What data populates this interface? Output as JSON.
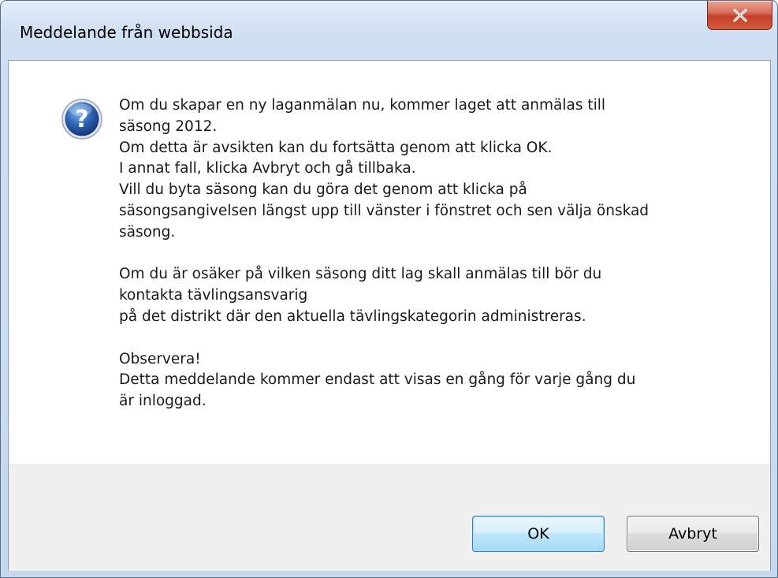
{
  "window": {
    "title": "Meddelande från webbsida"
  },
  "icons": {
    "close": "close-icon",
    "question": "question-icon"
  },
  "colors": {
    "close_button": "#c7432d",
    "question_icon": "#2d62b5",
    "footer_background": "#f0f0f0"
  },
  "message": {
    "lines": [
      "Om du skapar en ny laganmälan nu, kommer laget att anmälas till",
      "säsong 2012.",
      "Om detta är avsikten kan du fortsätta genom att klicka OK.",
      "I annat fall, klicka Avbryt och gå tillbaka.",
      "Vill du byta säsong kan du göra det genom att klicka på",
      "säsongsangivelsen längst upp till vänster i fönstret och sen välja önskad",
      "säsong.",
      "",
      "Om du är osäker på vilken säsong ditt lag skall anmälas till bör du",
      "kontakta tävlingsansvarig",
      "på det distrikt där den aktuella tävlingskategorin administreras.",
      "",
      "Observera!",
      "Detta meddelande kommer endast att visas en gång för varje gång du",
      "är inloggad."
    ]
  },
  "buttons": {
    "ok_label": "OK",
    "cancel_label": "Avbryt"
  }
}
